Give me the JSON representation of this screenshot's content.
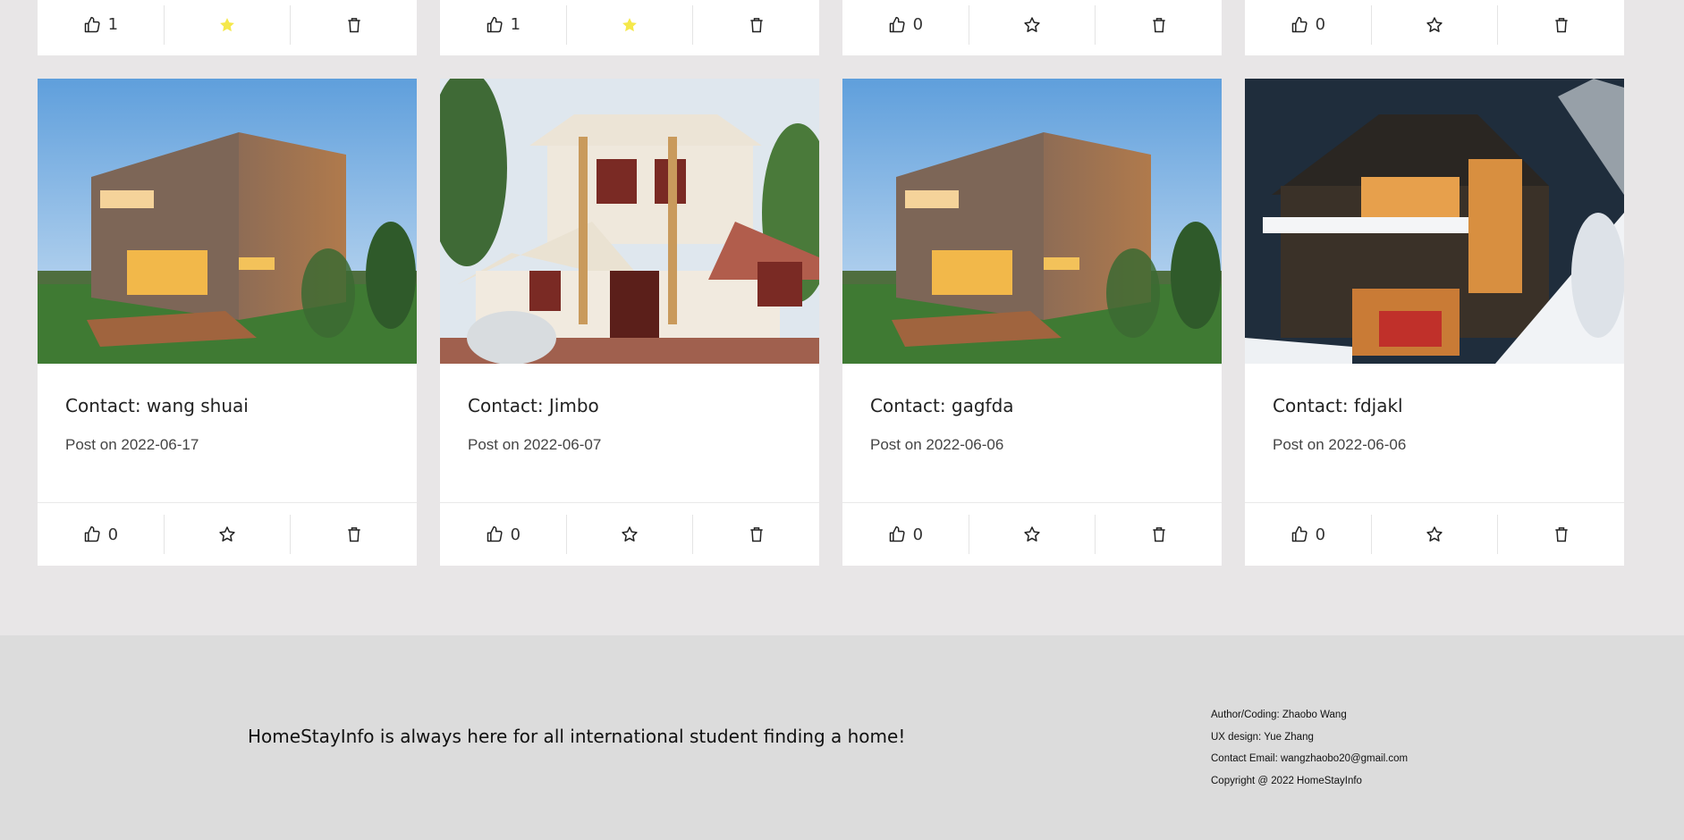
{
  "top_cards": [
    {
      "likes": "1",
      "favorited": true
    },
    {
      "likes": "1",
      "favorited": true
    },
    {
      "likes": "0",
      "favorited": false
    },
    {
      "likes": "0",
      "favorited": false
    }
  ],
  "cards": [
    {
      "contact": "Contact: wang shuai",
      "posted": "Post on 2022-06-17",
      "likes": "0",
      "favorited": false,
      "photo": "modern wooden house at dusk"
    },
    {
      "contact": "Contact: Jimbo",
      "posted": "Post on 2022-06-07",
      "likes": "0",
      "favorited": false,
      "photo": "two-storey white villa with car"
    },
    {
      "contact": "Contact: gagfda",
      "posted": "Post on 2022-06-06",
      "likes": "0",
      "favorited": false,
      "photo": "modern wooden house at dusk"
    },
    {
      "contact": "Contact: fdjakl",
      "posted": "Post on 2022-06-06",
      "likes": "0",
      "favorited": false,
      "photo": "dark house in snow at night"
    }
  ],
  "footer": {
    "tagline": "HomeStayInfo is always here for all international student finding a home!",
    "credits": [
      "Author/Coding: Zhaobo Wang",
      "UX design: Yue Zhang",
      "Contact Email: wangzhaobo20@gmail.com",
      "Copyright @ 2022 HomeStayInfo"
    ]
  },
  "colors": {
    "favorite_star": "#f5e84a",
    "page_bg": "#e8e6e7",
    "footer_bg": "#dcdcdc"
  }
}
